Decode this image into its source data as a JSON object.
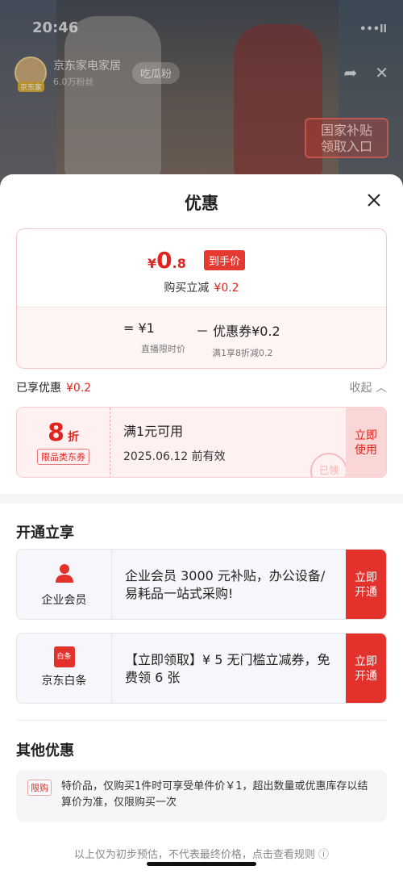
{
  "status": {
    "time": "20:46",
    "signal": "•••ll"
  },
  "stream": {
    "shop_name": "京东家电家居",
    "fans": "6.0万粉丝",
    "avatar_tag": "京东家",
    "fans_button": "吃瓜粉",
    "badge_line1": "国家补贴",
    "badge_line2": "领取入口"
  },
  "sheet": {
    "title": "优惠",
    "price": {
      "yen": "¥",
      "integer": "0",
      "decimal": ".8",
      "tag": "到手价",
      "reduce_label": "购买立减",
      "reduce_value": "¥0.2",
      "base_main": "= ¥1",
      "base_sub": "直播限时价",
      "coupon_main": "－ 优惠券¥0.2",
      "coupon_sub": "满1享8折减0.2"
    },
    "enjoyed": {
      "label": "已享优惠",
      "value": "¥0.2",
      "collapse": "收起 ︿"
    },
    "coupon": {
      "discount": "8",
      "unit": "折",
      "type": "限品类东券",
      "condition": "满1元可用",
      "valid": "2025.06.12 前有效",
      "button_line1": "立即",
      "button_line2": "使用",
      "stamp": "已领"
    },
    "open_section": {
      "title": "开通立享",
      "cards": [
        {
          "name": "企业会员",
          "text": " 企业会员 3000 元补贴，办公设备/易耗品一站式采购!",
          "btn1": "立即",
          "btn2": "开通"
        },
        {
          "name": "京东白条",
          "icon_text": "白条",
          "text": "【立即领取】¥ 5 无门槛立减券，免费领 6 张",
          "btn1": "立即",
          "btn2": "开通"
        }
      ]
    },
    "other_section": {
      "title": "其他优惠",
      "tag": "限购",
      "text": "特价品，仅购买1件时可享受单件价￥1，超出数量或优惠库存以结算价为准，仅限购买一次"
    },
    "footer": "以上仅为初步预估，不代表最终价格，点击查看规则 ⓘ"
  },
  "colors": {
    "accent": "#e0251f",
    "button": "#e3322c"
  }
}
